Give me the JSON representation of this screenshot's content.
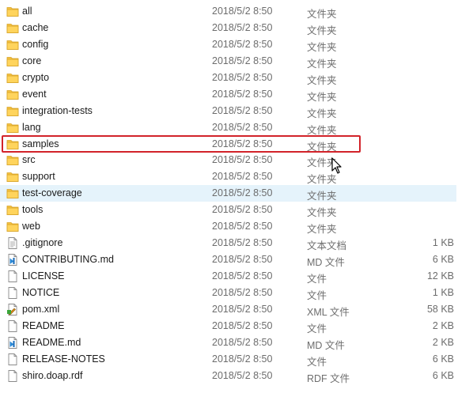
{
  "files": [
    {
      "name": "all",
      "date": "2018/5/2 8:50",
      "type": "文件夹",
      "size": "",
      "icon": "folder-icon"
    },
    {
      "name": "cache",
      "date": "2018/5/2 8:50",
      "type": "文件夹",
      "size": "",
      "icon": "folder-icon"
    },
    {
      "name": "config",
      "date": "2018/5/2 8:50",
      "type": "文件夹",
      "size": "",
      "icon": "folder-icon"
    },
    {
      "name": "core",
      "date": "2018/5/2 8:50",
      "type": "文件夹",
      "size": "",
      "icon": "folder-icon"
    },
    {
      "name": "crypto",
      "date": "2018/5/2 8:50",
      "type": "文件夹",
      "size": "",
      "icon": "folder-icon"
    },
    {
      "name": "event",
      "date": "2018/5/2 8:50",
      "type": "文件夹",
      "size": "",
      "icon": "folder-icon"
    },
    {
      "name": "integration-tests",
      "date": "2018/5/2 8:50",
      "type": "文件夹",
      "size": "",
      "icon": "folder-icon"
    },
    {
      "name": "lang",
      "date": "2018/5/2 8:50",
      "type": "文件夹",
      "size": "",
      "icon": "folder-icon"
    },
    {
      "name": "samples",
      "date": "2018/5/2 8:50",
      "type": "文件夹",
      "size": "",
      "icon": "folder-icon"
    },
    {
      "name": "src",
      "date": "2018/5/2 8:50",
      "type": "文件夹",
      "size": "",
      "icon": "folder-icon"
    },
    {
      "name": "support",
      "date": "2018/5/2 8:50",
      "type": "文件夹",
      "size": "",
      "icon": "folder-icon"
    },
    {
      "name": "test-coverage",
      "date": "2018/5/2 8:50",
      "type": "文件夹",
      "size": "",
      "icon": "folder-icon"
    },
    {
      "name": "tools",
      "date": "2018/5/2 8:50",
      "type": "文件夹",
      "size": "",
      "icon": "folder-icon"
    },
    {
      "name": "web",
      "date": "2018/5/2 8:50",
      "type": "文件夹",
      "size": "",
      "icon": "folder-icon"
    },
    {
      "name": ".gitignore",
      "date": "2018/5/2 8:50",
      "type": "文本文档",
      "size": "1 KB",
      "icon": "text-file-icon"
    },
    {
      "name": "CONTRIBUTING.md",
      "date": "2018/5/2 8:50",
      "type": "MD 文件",
      "size": "6 KB",
      "icon": "vscode-file-icon"
    },
    {
      "name": "LICENSE",
      "date": "2018/5/2 8:50",
      "type": "文件",
      "size": "12 KB",
      "icon": "blank-file-icon"
    },
    {
      "name": "NOTICE",
      "date": "2018/5/2 8:50",
      "type": "文件",
      "size": "1 KB",
      "icon": "blank-file-icon"
    },
    {
      "name": "pom.xml",
      "date": "2018/5/2 8:50",
      "type": "XML 文件",
      "size": "58 KB",
      "icon": "xml-file-icon"
    },
    {
      "name": "README",
      "date": "2018/5/2 8:50",
      "type": "文件",
      "size": "2 KB",
      "icon": "blank-file-icon"
    },
    {
      "name": "README.md",
      "date": "2018/5/2 8:50",
      "type": "MD 文件",
      "size": "2 KB",
      "icon": "vscode-file-icon"
    },
    {
      "name": "RELEASE-NOTES",
      "date": "2018/5/2 8:50",
      "type": "文件",
      "size": "6 KB",
      "icon": "blank-file-icon"
    },
    {
      "name": "shiro.doap.rdf",
      "date": "2018/5/2 8:50",
      "type": "RDF 文件",
      "size": "6 KB",
      "icon": "blank-file-icon"
    }
  ],
  "highlighted_item": "samples",
  "hovered_item": "test-coverage",
  "colors": {
    "highlight_border": "#d2232a",
    "hover_background": "#e5f3fb",
    "folder_yellow": "#f5c242"
  }
}
